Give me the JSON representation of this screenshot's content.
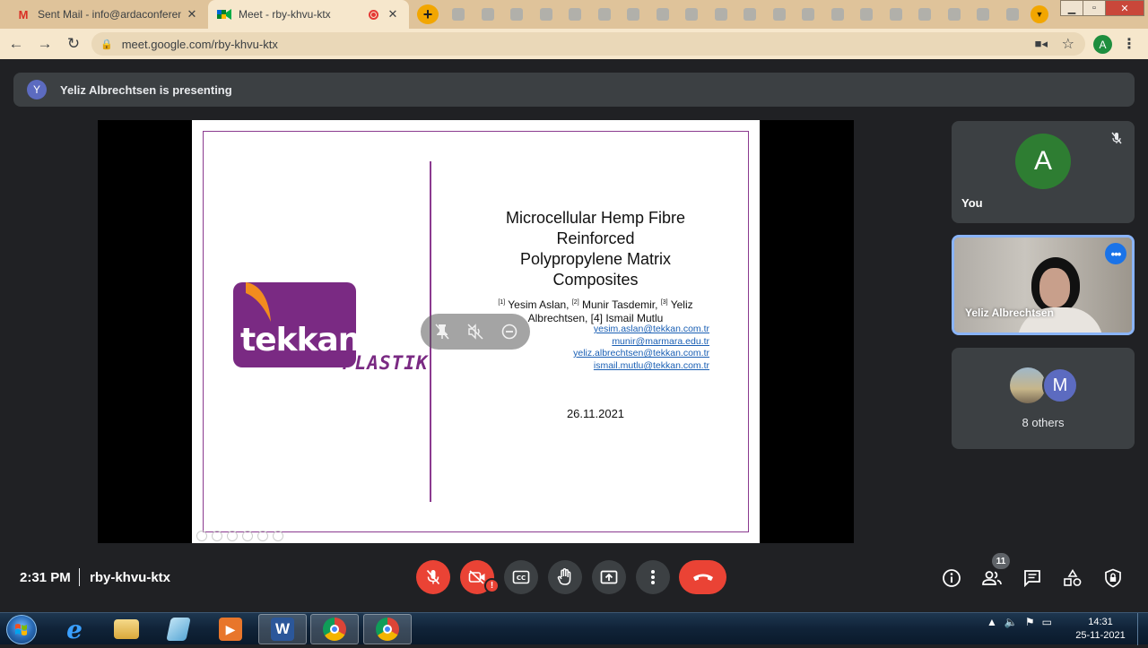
{
  "browser": {
    "tabs": [
      {
        "title": "Sent Mail - info@ardaconference",
        "icon": "gmail-icon",
        "active": false
      },
      {
        "title": "Meet - rby-khvu-ktx",
        "icon": "meet-icon",
        "active": true
      }
    ],
    "new_tab_label": "+",
    "url": "meet.google.com/rby-khvu-ktx",
    "profile_initial": "A",
    "window_buttons": {
      "minimize": "▁",
      "maximize": "▫",
      "close": "✕"
    }
  },
  "meet": {
    "presenting_banner": {
      "avatar_initial": "Y",
      "text": "Yeliz Albrechtsen is presenting"
    },
    "slide": {
      "logo_main": "tekkan",
      "logo_sub": "PLASTIK",
      "title_lines": [
        "Microcellular Hemp Fibre",
        "Reinforced",
        "Polypropylene Matrix",
        "Composites"
      ],
      "authors": {
        "a1_mark": "[1]",
        "a1": " Yesim Aslan, ",
        "a2_mark": "[2]",
        "a2": " Munir Tasdemir, ",
        "a3_mark": "[3]",
        "a3": " Yeliz Albrechtsen, [4] Ismail Mutlu"
      },
      "emails": [
        "yesim.aslan@tekkan.com.tr",
        "munir@marmara.edu.tr",
        "yeliz.albrechtsen@tekkan.com.tr",
        "ismail.mutlu@tekkan.com.tr"
      ],
      "date": "26.11.2021"
    },
    "participants": {
      "you": {
        "initial": "A",
        "label": "You",
        "avatar_color": "#2e7d32"
      },
      "presenter": {
        "name": "Yeliz Albrechtsen"
      },
      "others": {
        "initial": "M",
        "label": "8 others"
      }
    },
    "footer": {
      "time": "2:31 PM",
      "meeting_code": "rby-khvu-ktx",
      "cam_alert": "!",
      "people_count": "11"
    },
    "colors": {
      "danger": "#ea4335",
      "accent": "#8ab4f8",
      "surface": "#3c4043",
      "background": "#202124"
    }
  },
  "taskbar": {
    "clock_time": "14:31",
    "clock_date": "25-11-2021",
    "word_letter": "W"
  }
}
